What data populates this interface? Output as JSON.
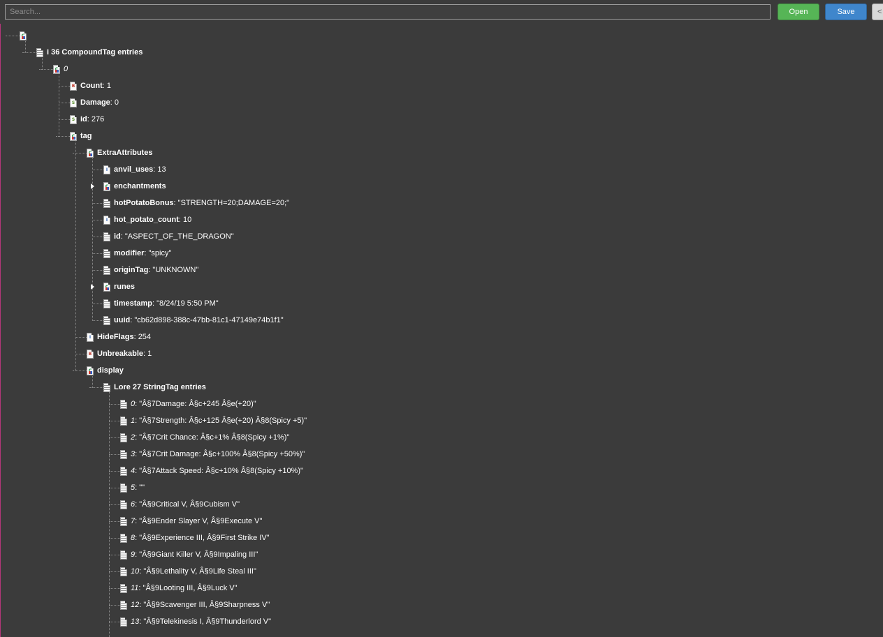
{
  "toolbar": {
    "search_placeholder": "Search...",
    "open_label": "Open",
    "save_label": "Save",
    "more_label": "<"
  },
  "tree": {
    "root": {
      "label": "",
      "icon": "compound-tag-icon"
    },
    "i": {
      "label": "i 36 CompoundTag entries",
      "icon": "list-tag-icon"
    },
    "item0": {
      "index": "0",
      "icon": "compound-tag-icon"
    },
    "count": {
      "key": "Count",
      "value": ": 1",
      "icon": "byte-tag-icon"
    },
    "damage": {
      "key": "Damage",
      "value": ": 0",
      "icon": "short-tag-icon"
    },
    "id": {
      "key": "id",
      "value": ": 276",
      "icon": "short-tag-icon"
    },
    "tag": {
      "key": "tag",
      "icon": "compound-tag-icon"
    },
    "extra": {
      "key": "ExtraAttributes",
      "icon": "compound-tag-icon"
    },
    "anvil": {
      "key": "anvil_uses",
      "value": ": 13",
      "icon": "int-tag-icon"
    },
    "enchantments": {
      "key": "enchantments",
      "icon": "compound-tag-icon"
    },
    "hotpotatobonus": {
      "key": "hotPotatoBonus",
      "value": ": \"STRENGTH=20;DAMAGE=20;\"",
      "icon": "string-tag-icon"
    },
    "hotpotatocount": {
      "key": "hot_potato_count",
      "value": ": 10",
      "icon": "int-tag-icon"
    },
    "eid": {
      "key": "id",
      "value": ": \"ASPECT_OF_THE_DRAGON\"",
      "icon": "string-tag-icon"
    },
    "modifier": {
      "key": "modifier",
      "value": ": \"spicy\"",
      "icon": "string-tag-icon"
    },
    "origintag": {
      "key": "originTag",
      "value": ": \"UNKNOWN\"",
      "icon": "string-tag-icon"
    },
    "runes": {
      "key": "runes",
      "icon": "compound-tag-icon"
    },
    "timestamp": {
      "key": "timestamp",
      "value": ": \"8/24/19 5:50 PM\"",
      "icon": "string-tag-icon"
    },
    "uuid": {
      "key": "uuid",
      "value": ": \"cb62d898-388c-47bb-81c1-47149e74b1f1\"",
      "icon": "string-tag-icon"
    },
    "hideflags": {
      "key": "HideFlags",
      "value": ": 254",
      "icon": "int-tag-icon"
    },
    "unbreakable": {
      "key": "Unbreakable",
      "value": ": 1",
      "icon": "byte-tag-icon"
    },
    "display": {
      "key": "display",
      "icon": "compound-tag-icon"
    },
    "lore": {
      "label": "Lore 27 StringTag entries",
      "icon": "list-tag-icon"
    },
    "lore_items": [
      {
        "index": "0",
        "value": ": \"Â§7Damage: Â§c+245 Â§e(+20)\""
      },
      {
        "index": "1",
        "value": ": \"Â§7Strength: Â§c+125 Â§e(+20) Â§8(Spicy +5)\""
      },
      {
        "index": "2",
        "value": ": \"Â§7Crit Chance: Â§c+1% Â§8(Spicy +1%)\""
      },
      {
        "index": "3",
        "value": ": \"Â§7Crit Damage: Â§c+100% Â§8(Spicy +50%)\""
      },
      {
        "index": "4",
        "value": ": \"Â§7Attack Speed: Â§c+10% Â§8(Spicy +10%)\""
      },
      {
        "index": "5",
        "value": ": \"\""
      },
      {
        "index": "6",
        "value": ": \"Â§9Critical V, Â§9Cubism V\""
      },
      {
        "index": "7",
        "value": ": \"Â§9Ender Slayer V, Â§9Execute V\""
      },
      {
        "index": "8",
        "value": ": \"Â§9Experience III, Â§9First Strike IV\""
      },
      {
        "index": "9",
        "value": ": \"Â§9Giant Killer V, Â§9Impaling III\""
      },
      {
        "index": "10",
        "value": ": \"Â§9Lethality V, Â§9Life Steal III\""
      },
      {
        "index": "11",
        "value": ": \"Â§9Looting III, Â§9Luck V\""
      },
      {
        "index": "12",
        "value": ": \"Â§9Scavenger III, Â§9Sharpness V\""
      },
      {
        "index": "13",
        "value": ": \"Â§9Telekinesis I, Â§9Thunderlord V\""
      }
    ]
  }
}
